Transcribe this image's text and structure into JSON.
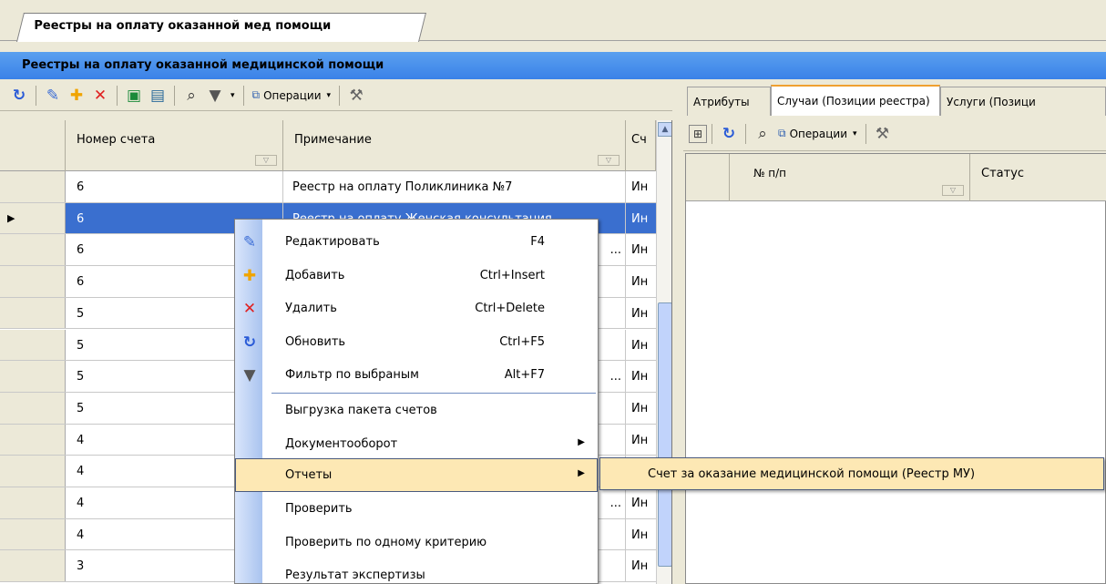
{
  "document_tab": {
    "label": "Реестры на оплату оказанной мед помощи"
  },
  "panel_title": "Реестры на оплату оказанной медицинской помощи",
  "left_toolbar": {
    "operations_label": "Операции"
  },
  "grid": {
    "columns": [
      "Номер счета",
      "Примечание",
      "Сч"
    ],
    "rows": [
      {
        "c1": "6",
        "c2": "Реестр на оплату Поликлиника №7",
        "c3": "Ин"
      },
      {
        "c1": "6",
        "c2": "Реестр на оплату Женская консультация",
        "c3": "Ин"
      },
      {
        "c1": "6",
        "c2": "...",
        "c3": "Ин"
      },
      {
        "c1": "6",
        "c2": "",
        "c3": "Ин"
      },
      {
        "c1": "5",
        "c2": "",
        "c3": "Ин"
      },
      {
        "c1": "5",
        "c2": "",
        "c3": "Ин"
      },
      {
        "c1": "5",
        "c2": "...",
        "c3": "Ин"
      },
      {
        "c1": "5",
        "c2": "",
        "c3": "Ин"
      },
      {
        "c1": "4",
        "c2": "",
        "c3": "Ин"
      },
      {
        "c1": "4",
        "c2": "",
        "c3": "Ин"
      },
      {
        "c1": "4",
        "c2": "...",
        "c3": "Ин"
      },
      {
        "c1": "4",
        "c2": "",
        "c3": "Ин"
      },
      {
        "c1": "3",
        "c2": "",
        "c3": "Ин"
      }
    ]
  },
  "right_tabs": [
    "Атрибуты",
    "Случаи (Позиции реестра)",
    "Услуги (Позици"
  ],
  "right_toolbar": {
    "operations_label": "Операции"
  },
  "right_grid": {
    "columns": [
      "№ п/п",
      "Статус"
    ]
  },
  "context_menu": {
    "items": [
      {
        "label": "Редактировать",
        "shortcut": "F4",
        "icon": "edit-icon"
      },
      {
        "label": "Добавить",
        "shortcut": "Ctrl+Insert",
        "icon": "add-icon"
      },
      {
        "label": "Удалить",
        "shortcut": "Ctrl+Delete",
        "icon": "delete-icon"
      },
      {
        "label": "Обновить",
        "shortcut": "Ctrl+F5",
        "icon": "refresh-icon"
      },
      {
        "label": "Фильтр по выбраным",
        "shortcut": "Alt+F7",
        "icon": "filter-icon"
      },
      {
        "label": "Выгрузка пакета счетов",
        "shortcut": ""
      },
      {
        "label": "Документооборот",
        "shortcut": "",
        "submenu": true
      },
      {
        "label": "Отчеты",
        "shortcut": "",
        "submenu": true,
        "highlighted": true
      },
      {
        "label": "Проверить",
        "shortcut": ""
      },
      {
        "label": "Проверить по одному критерию",
        "shortcut": ""
      },
      {
        "label": "Результат экспертизы",
        "shortcut": ""
      }
    ]
  },
  "submenu": {
    "items": [
      {
        "label": "Счет за оказание медицинской помощи (Реестр МУ)"
      }
    ]
  },
  "colors": {
    "title_bar": "#3a82e8",
    "selection": "#3a6fcf",
    "menu_highlight": "#fde8b4"
  }
}
